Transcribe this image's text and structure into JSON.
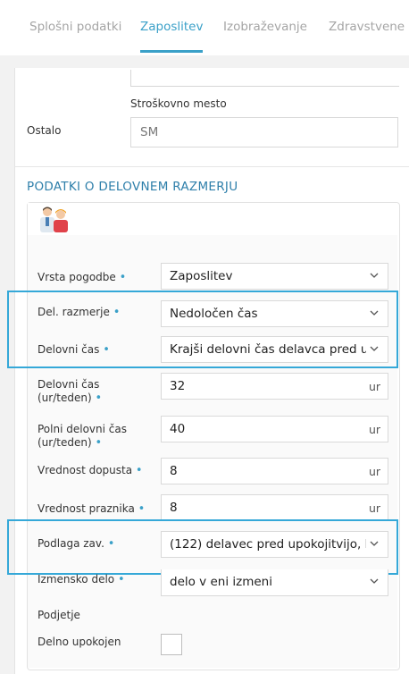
{
  "tabs": [
    {
      "label": "Splošni podatki",
      "active": false
    },
    {
      "label": "Zaposlitev",
      "active": true
    },
    {
      "label": "Izobraževanje",
      "active": false
    },
    {
      "label": "Zdravstvene",
      "active": false
    }
  ],
  "top_section": {
    "stroskovno_label": "Stroškovno mesto",
    "ostalo_label": "Ostalo",
    "stroskovno_value": "SM"
  },
  "section_title": "PODATKI O DELOVNEM RAZMERJU",
  "icon": "people-icon",
  "form": {
    "vrsta_pogodbe": {
      "label": "Vrsta pogodbe",
      "value": "Zaposlitev"
    },
    "del_razmerje": {
      "label": "Del. razmerje",
      "value": "Nedoločen čas"
    },
    "delovni_cas": {
      "label": "Delovni čas",
      "value": "Krajši delovni čas delavca pred u"
    },
    "delovni_cas_ur": {
      "label_1": "Delovni čas",
      "label_2": "(ur/teden)",
      "value": "32",
      "unit": "ur"
    },
    "polni_delovni_cas": {
      "label_1": "Polni delovni čas",
      "label_2": "(ur/teden)",
      "value": "40",
      "unit": "ur"
    },
    "vrednost_dopusta": {
      "label": "Vrednost dopusta",
      "value": "8",
      "unit": "ur"
    },
    "vrednost_praznika": {
      "label": "Vrednost praznika",
      "value": "8",
      "unit": "ur"
    },
    "podlaga_zav": {
      "label": "Podlaga zav.",
      "value": "(122) delavec pred upokojitvijo, k"
    },
    "izmensko_delo": {
      "label": "Izmensko delo",
      "value": "delo v eni izmeni"
    },
    "podjetje": {
      "label": "Podjetje"
    },
    "delno_upokojen": {
      "label": "Delno upokojen",
      "checked": false
    }
  },
  "required_marker": "•",
  "colors": {
    "accent": "#3aa0c8",
    "highlight": "#35a8d8",
    "section_title": "#2e7faa"
  }
}
